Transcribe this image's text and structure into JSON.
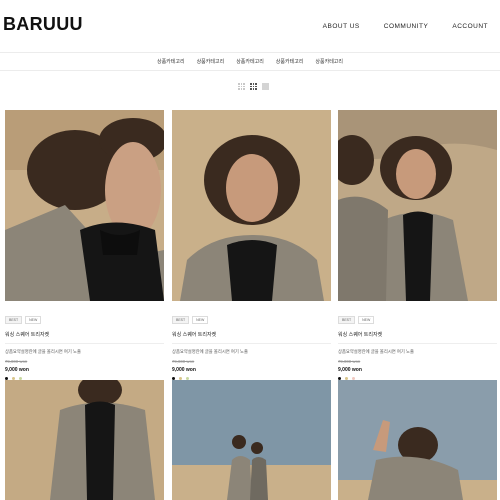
{
  "header": {
    "logo": "BARUUU",
    "nav": [
      "ABOUT US",
      "COMMUNITY",
      "ACCOUNT"
    ]
  },
  "categories": [
    "상품카테고리",
    "상품카테고리",
    "상품카테고리",
    "상품카테고리",
    "상품카테고리"
  ],
  "view_toggle": [
    "grid-3-icon",
    "grid-4-icon",
    "list-icon"
  ],
  "products": [
    {
      "badges": [
        "BEST",
        "NEW"
      ],
      "name": "워싱 스퀘어 트리자켓",
      "description": "상품요약설명란에 글을 올리시면 여기 노출",
      "old_price": "79,000 won",
      "price": "9,000 won",
      "swatches": [
        "#111111",
        "#d9c58a",
        "#c8d8a0"
      ]
    },
    {
      "badges": [
        "BEST",
        "NEW"
      ],
      "name": "워싱 스퀘어 트리자켓",
      "description": "상품요약설명란에 글을 올리시면 여기 노출",
      "old_price": "79,000 won",
      "price": "9,000 won",
      "swatches": [
        "#111111",
        "#d9c58a",
        "#c8d8a0"
      ]
    },
    {
      "badges": [
        "BEST",
        "NEW"
      ],
      "name": "워싱 스퀘어 트리자켓",
      "description": "상품요약설명란에 글을 올리시면 여기 노출",
      "old_price": "79,000 won",
      "price": "9,000 won",
      "swatches": [
        "#111111",
        "#d9c58a",
        "#f0c9c0"
      ]
    }
  ],
  "colors": {
    "sand": "#c9b08a",
    "sky": "#7f96a6",
    "coat": "#8c8578",
    "hair": "#3a2a1f",
    "accent": "#111111"
  }
}
